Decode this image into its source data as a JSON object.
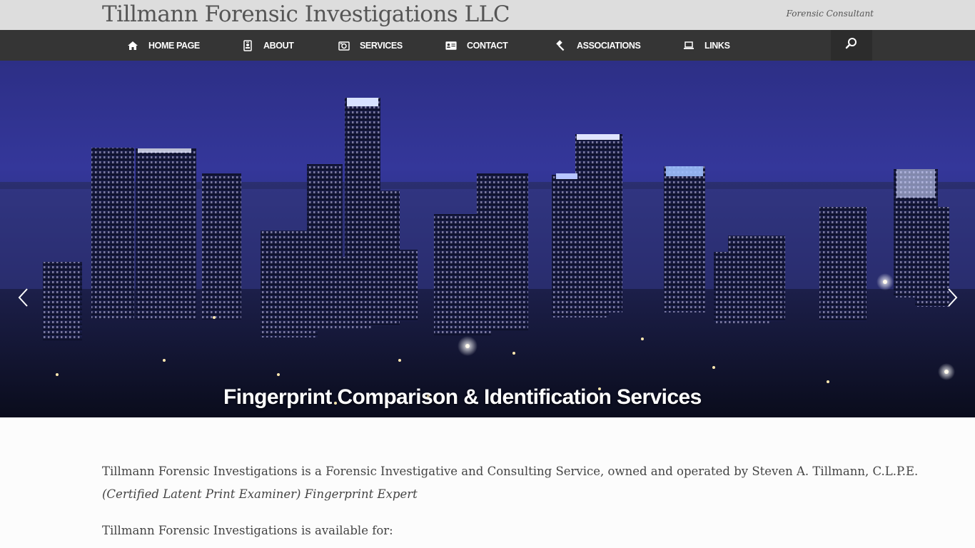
{
  "header": {
    "site_title": "Tillmann Forensic Investigations LLC",
    "tagline": "Forensic Consultant"
  },
  "nav": {
    "items": [
      {
        "label": "HOME PAGE",
        "icon": "home-icon"
      },
      {
        "label": "ABOUT",
        "icon": "id-badge-icon"
      },
      {
        "label": "SERVICES",
        "icon": "camera-icon"
      },
      {
        "label": "CONTACT",
        "icon": "contact-card-icon"
      },
      {
        "label": "ASSOCIATIONS",
        "icon": "gavel-icon"
      },
      {
        "label": "LINKS",
        "icon": "laptop-icon"
      }
    ],
    "search_icon": "search-icon"
  },
  "slider": {
    "caption": "Fingerprint Comparison & Identification Services",
    "prev_icon": "chevron-left-icon",
    "next_icon": "chevron-right-icon"
  },
  "content": {
    "intro_line1": "Tillmann Forensic Investigations is a Forensic Investigative and Consulting Service, owned and operated by Steven A. Tillmann, C.L.P.E.",
    "intro_line2": "(Certified Latent Print Examiner) Fingerprint Expert",
    "available_for": "Tillmann Forensic Investigations is available for:"
  },
  "colors": {
    "topbar": "#dddddd",
    "navbar": "#353535",
    "sky": "#2d2f86"
  }
}
